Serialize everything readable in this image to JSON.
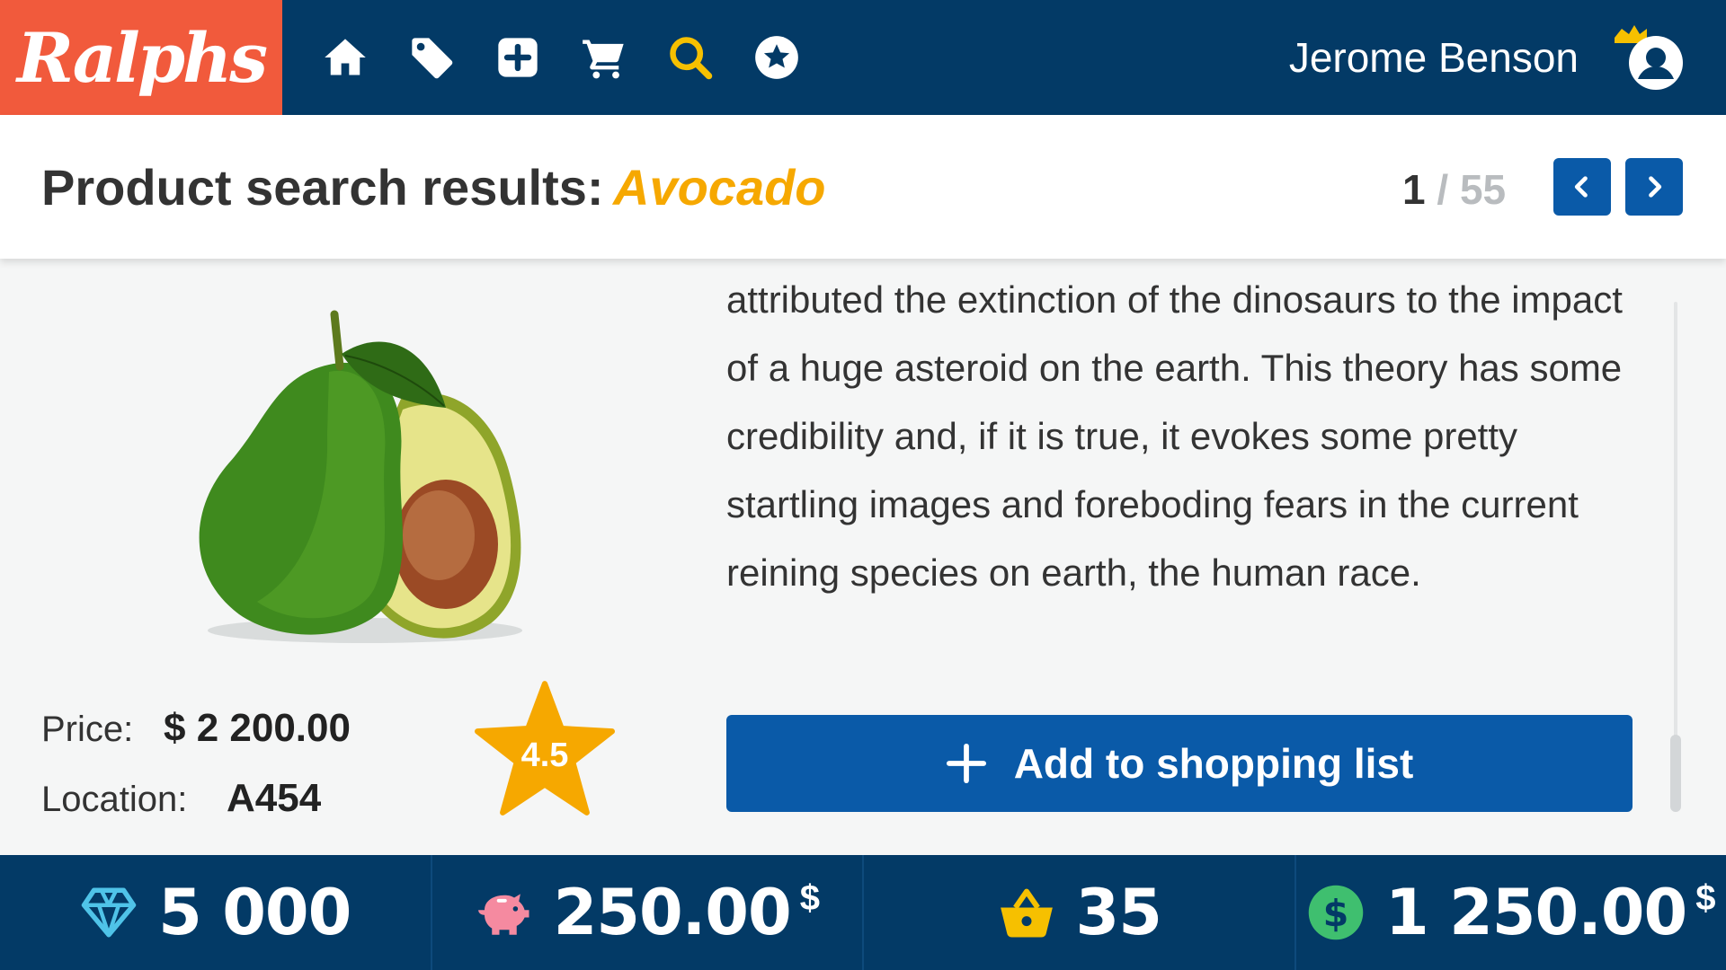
{
  "header": {
    "logo_text": "Ralphs",
    "nav": [
      {
        "name": "home-icon"
      },
      {
        "name": "tag-icon"
      },
      {
        "name": "plus-square-icon"
      },
      {
        "name": "cart-icon"
      },
      {
        "name": "search-icon",
        "active": true
      },
      {
        "name": "star-circle-icon"
      }
    ],
    "user_name": "Jerome Benson",
    "accent_color": "#f6a800",
    "logo_color": "#f15a3c",
    "bar_color": "#033a66"
  },
  "titlebar": {
    "label": "Product search results:",
    "query": "Avocado",
    "page_current": "1",
    "page_separator": "/",
    "page_total": "55"
  },
  "product": {
    "image_icon": "avocado-image",
    "price_label": "Price:",
    "price_value": "$ 2 200.00",
    "location_label": "Location:",
    "location_value": "A454",
    "rating": "4.5",
    "description": "attributed the extinction of the dinosaurs to the impact of a huge asteroid on the earth. This theory has some credibility and, if it is true, it evokes some pretty startling images and foreboding fears in the current reining species on earth, the human race.",
    "add_button_label": "Add to shopping list"
  },
  "footer": {
    "gems": "5 000",
    "savings": "250.00",
    "savings_unit": "$",
    "basket_count": "35",
    "balance": "1 250.00",
    "balance_unit": "$"
  }
}
